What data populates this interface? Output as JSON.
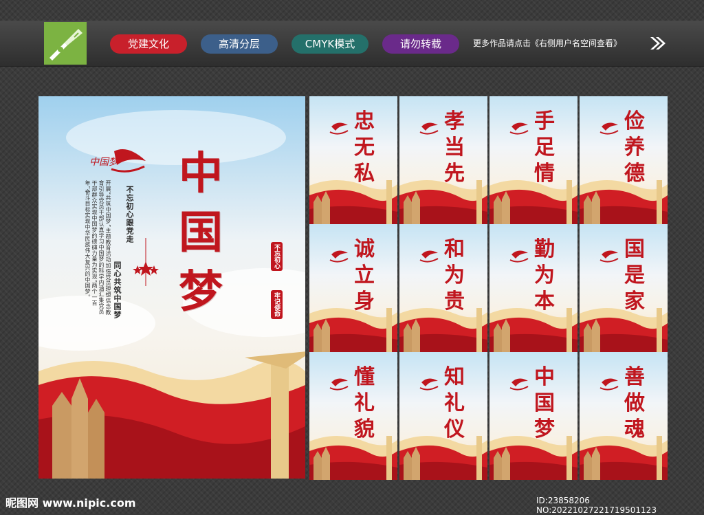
{
  "header": {
    "tags": [
      "党建文化",
      "高清分层",
      "CMYK模式",
      "请勿转载"
    ],
    "tag_colors": [
      "#c8202b",
      "#3c5f8a",
      "#24706a",
      "#6a2a8a"
    ],
    "more_text": "更多作品请点击《右侧用户名空间查看》",
    "logo_icon": "pen-tool-icon",
    "arrow_icon": "double-chevron-right-icon"
  },
  "main_poster": {
    "title": "中国梦",
    "slogan_1": "不忘初心跟党走",
    "slogan_2": "同心共筑中国梦",
    "body": "开展“共筑中国梦”主题教育活动加强党员理想信念教育引导党员干部认真学习中国梦的科学内涵汇集党员干部群众实现中国梦的磅礴力量为实现“两个一百年”奋斗目标实现中华民族伟大复兴的中国梦。",
    "badge_1": "不忘初心",
    "badge_2": "牢记使命",
    "accent_color": "#c0161e"
  },
  "panels": [
    {
      "title": "忠无私"
    },
    {
      "title": "孝当先"
    },
    {
      "title": "手足情"
    },
    {
      "title": "俭养德"
    },
    {
      "title": "诚立身"
    },
    {
      "title": "和为贵"
    },
    {
      "title": "勤为本"
    },
    {
      "title": "国是家"
    },
    {
      "title": "懂礼貌"
    },
    {
      "title": "知礼仪"
    },
    {
      "title": "中国梦"
    },
    {
      "title": "善做魂"
    }
  ],
  "footer": {
    "site": "昵图网 www.nipic.com",
    "id_text": "ID:23858206 NO:20221027221719501123"
  }
}
